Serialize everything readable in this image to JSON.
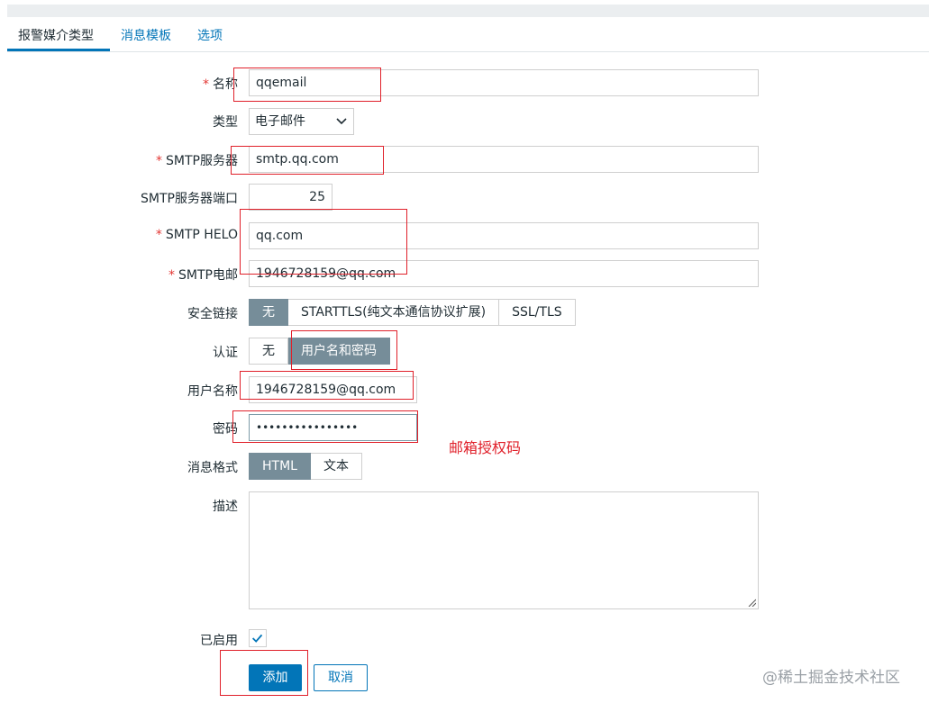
{
  "tabs": [
    {
      "label": "报警媒介类型"
    },
    {
      "label": "消息模板"
    },
    {
      "label": "选项"
    }
  ],
  "form": {
    "name": {
      "label": "名称",
      "value": "qqemail",
      "required": true
    },
    "type": {
      "label": "类型",
      "value": "电子邮件"
    },
    "smtp_server": {
      "label": "SMTP服务器",
      "value": "smtp.qq.com",
      "required": true
    },
    "smtp_port": {
      "label": "SMTP服务器端口",
      "value": "25"
    },
    "smtp_helo": {
      "label": "SMTP HELO",
      "value": "qq.com",
      "required": true
    },
    "smtp_email": {
      "label": "SMTP电邮",
      "value": "1946728159@qq.com",
      "required": true
    },
    "security": {
      "label": "安全链接",
      "options": [
        "无",
        "STARTTLS(纯文本通信协议扩展)",
        "SSL/TLS"
      ],
      "selected": "无"
    },
    "auth": {
      "label": "认证",
      "options": [
        "无",
        "用户名和密码"
      ],
      "selected": "用户名和密码"
    },
    "username": {
      "label": "用户名称",
      "value": "1946728159@qq.com"
    },
    "password": {
      "label": "密码",
      "value": "••••••••••••••••"
    },
    "message_format": {
      "label": "消息格式",
      "options": [
        "HTML",
        "文本"
      ],
      "selected": "HTML"
    },
    "description": {
      "label": "描述",
      "value": ""
    },
    "enabled": {
      "label": "已启用",
      "checked": true
    },
    "add_label": "添加",
    "cancel_label": "取消"
  },
  "annotation": {
    "text": "邮箱授权码"
  },
  "watermark": "@稀土掘金技术社区",
  "colors": {
    "primary": "#0275b8",
    "required": "#e33734",
    "annotation": "#e0202a",
    "segment_on": "#768d99"
  }
}
